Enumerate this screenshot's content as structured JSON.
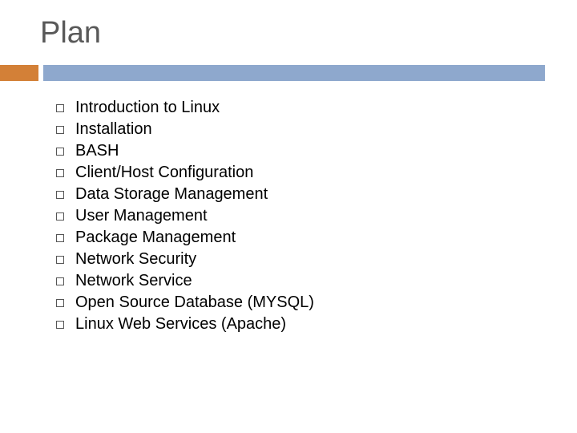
{
  "title": "Plan",
  "colors": {
    "accent": "#d38037",
    "bar": "#8ea8cd",
    "title_text": "#595959"
  },
  "bullets": {
    "items": [
      {
        "label": "Introduction to Linux"
      },
      {
        "label": "Installation"
      },
      {
        "label": "BASH"
      },
      {
        "label": "Client/Host Configuration"
      },
      {
        "label": "Data Storage Management"
      },
      {
        "label": "User Management"
      },
      {
        "label": "Package Management"
      },
      {
        "label": "Network Security"
      },
      {
        "label": "Network Service"
      },
      {
        "label": "Open Source Database (MYSQL)"
      },
      {
        "label": "Linux Web Services (Apache)"
      }
    ]
  }
}
